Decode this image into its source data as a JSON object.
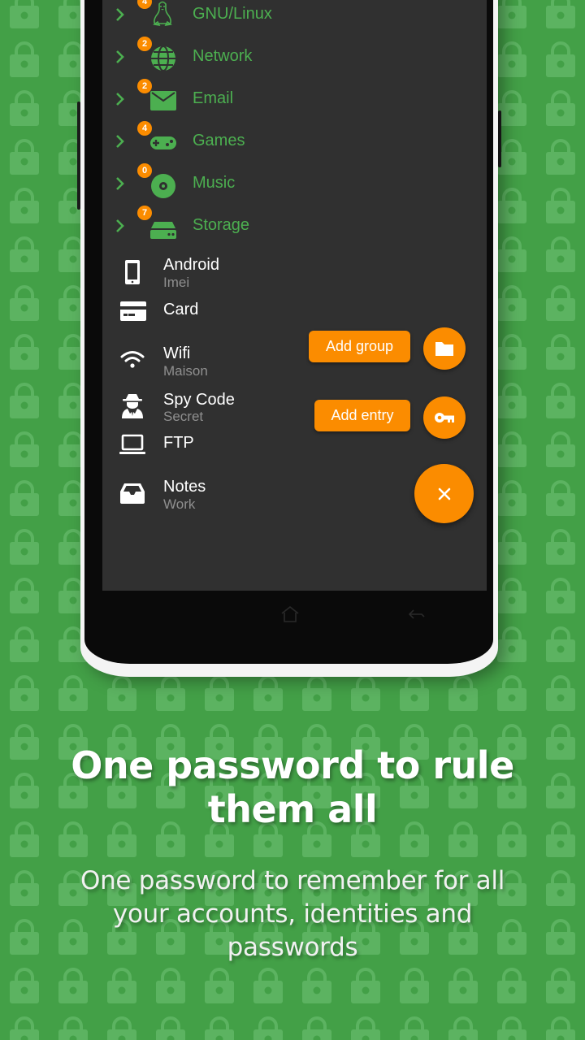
{
  "colors": {
    "background": "#43a047",
    "screen": "#303030",
    "accent": "#fb8c00",
    "group_text": "#4caf50",
    "entry_text": "#ffffff",
    "entry_subtext": "#8f8f8f"
  },
  "groups": [
    {
      "label": "GNU/Linux",
      "count": "4",
      "icon": "linux-penguin-icon"
    },
    {
      "label": "Network",
      "count": "2",
      "icon": "globe-icon"
    },
    {
      "label": "Email",
      "count": "2",
      "icon": "envelope-icon"
    },
    {
      "label": "Games",
      "count": "4",
      "icon": "gamepad-icon"
    },
    {
      "label": "Music",
      "count": "0",
      "icon": "disc-icon"
    },
    {
      "label": "Storage",
      "count": "7",
      "icon": "hard-drive-icon"
    }
  ],
  "entries": [
    {
      "title": "Android",
      "subtitle": "Imei",
      "icon": "smartphone-icon"
    },
    {
      "title": "Card",
      "subtitle": "",
      "icon": "credit-card-icon"
    },
    {
      "title": "Wifi",
      "subtitle": "Maison",
      "icon": "wifi-icon"
    },
    {
      "title": "Spy Code",
      "subtitle": "Secret",
      "icon": "spy-icon"
    },
    {
      "title": "FTP",
      "subtitle": "",
      "icon": "laptop-icon"
    },
    {
      "title": "Notes",
      "subtitle": "Work",
      "icon": "inbox-icon"
    }
  ],
  "fab": {
    "add_group_label": "Add group",
    "add_entry_label": "Add entry",
    "add_group_icon": "folder-icon",
    "add_entry_icon": "key-icon",
    "close_icon": "close-icon"
  },
  "navbar": {
    "home_icon": "home-icon",
    "back_icon": "back-icon"
  },
  "promo": {
    "headline_line1": "One password to rule",
    "headline_line2": "them all",
    "subline_line1": "One password to remember for all",
    "subline_line2": "your accounts, identities and",
    "subline_line3": "passwords"
  }
}
